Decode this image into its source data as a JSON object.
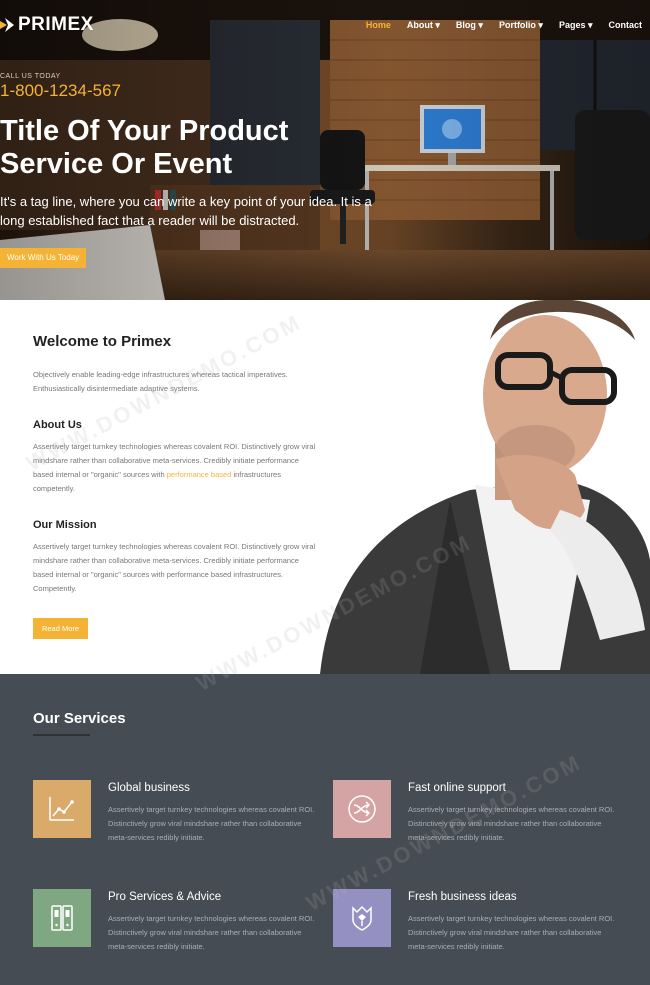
{
  "brand": {
    "name": "PRIMEX",
    "accent": "#f5b335"
  },
  "nav": {
    "items": [
      {
        "label": "Home",
        "active": true
      },
      {
        "label": "About ▾",
        "active": false
      },
      {
        "label": "Blog ▾",
        "active": false
      },
      {
        "label": "Portfolio ▾",
        "active": false
      },
      {
        "label": "Pages ▾",
        "active": false
      },
      {
        "label": "Contact",
        "active": false
      }
    ]
  },
  "hero": {
    "call_label": "CALL US TODAY",
    "phone": "1-800-1234-567",
    "title": "Title Of Your Product Service Or Event",
    "tagline": "It's a tag line, where you can write a key point of your idea. It is a long established fact that a reader will be distracted.",
    "button": "Work With Us Today"
  },
  "welcome": {
    "title": "Welcome to Primex",
    "intro": "Objectively enable leading-edge infrastructures whereas tactical imperatives. Enthusiastically disintermediate adaptive systems.",
    "about": {
      "title": "About Us",
      "text_before": "Assertively target turnkey technologies whereas covalent ROI. Distinctively grow viral mindshare rather than collaborative meta-services. Credibly initiate performance based internal or \"organic\" sources with ",
      "link": "performance based",
      "text_after": " infrastructures competently."
    },
    "mission": {
      "title": "Our Mission",
      "text": "Assertively target turnkey technologies whereas covalent ROI. Distinctively grow viral mindshare rather than collaborative meta-services. Credibly initiate performance based internal or \"organic\" sources with performance based infrastructures. Competently."
    },
    "read_more": "Read More"
  },
  "services": {
    "title": "Our Services",
    "items": [
      {
        "title": "Global business",
        "icon": "chart-icon",
        "color": "#d9aa6a",
        "text": "Assertively target turnkey technologies whereas covalent ROI. Distinctively grow viral mindshare rather than collaborative meta-services redibly initiate."
      },
      {
        "title": "Fast online support",
        "icon": "shuffle-icon",
        "color": "#d4a3a3",
        "text": "Assertively target turnkey technologies whereas covalent ROI. Distinctively grow viral mindshare rather than collaborative meta-services redibly initiate."
      },
      {
        "title": "Pro Services & Advice",
        "icon": "phones-icon",
        "color": "#7fa882",
        "text": "Assertively target turnkey technologies whereas covalent ROI. Distinctively grow viral mindshare rather than collaborative meta-services redibly initiate."
      },
      {
        "title": "Fresh business ideas",
        "icon": "shield-icon",
        "color": "#9491c2",
        "text": "Assertively target turnkey technologies whereas covalent ROI. Distinctively grow viral mindshare rather than collaborative meta-services redibly initiate."
      }
    ]
  },
  "watermark": "WWW.DOWNDEMO.COM"
}
